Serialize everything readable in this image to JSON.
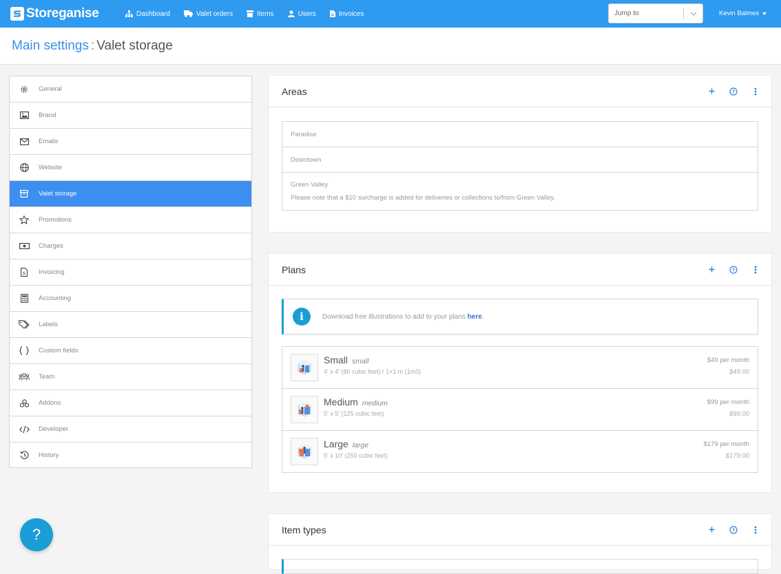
{
  "app": {
    "brand": "Storeganise"
  },
  "nav": {
    "items": [
      {
        "label": "Dashboard",
        "icon": "sitemap-icon"
      },
      {
        "label": "Valet orders",
        "icon": "truck-icon"
      },
      {
        "label": "Items",
        "icon": "box-icon"
      },
      {
        "label": "Users",
        "icon": "user-icon"
      },
      {
        "label": "Invoices",
        "icon": "document-icon"
      }
    ],
    "jump_placeholder": "Jump to",
    "user_name": "Kevin Balmes"
  },
  "header": {
    "crumb": "Main settings",
    "separator": ":",
    "title": "Valet storage"
  },
  "sidebar": {
    "items": [
      {
        "label": "General",
        "icon": "gear-icon"
      },
      {
        "label": "Brand",
        "icon": "image-icon"
      },
      {
        "label": "Emails",
        "icon": "envelope-icon"
      },
      {
        "label": "Website",
        "icon": "globe-icon"
      },
      {
        "label": "Valet storage",
        "icon": "archive-icon",
        "active": true
      },
      {
        "label": "Promotions",
        "icon": "star-icon"
      },
      {
        "label": "Charges",
        "icon": "banknote-icon"
      },
      {
        "label": "Invoicing",
        "icon": "invoice-icon"
      },
      {
        "label": "Accounting",
        "icon": "calculator-icon"
      },
      {
        "label": "Labels",
        "icon": "tags-icon"
      },
      {
        "label": "Custom fields",
        "icon": "braces-icon"
      },
      {
        "label": "Team",
        "icon": "users-icon"
      },
      {
        "label": "Addons",
        "icon": "cubes-icon"
      },
      {
        "label": "Developer",
        "icon": "code-icon"
      },
      {
        "label": "History",
        "icon": "history-icon"
      }
    ]
  },
  "areas": {
    "title": "Areas",
    "items": [
      {
        "name": "Paradise"
      },
      {
        "name": "Downtown"
      },
      {
        "name": "Green Valley",
        "note": "Please note that a $10 surcharge is added for deliveries or collections to/from Green Valley."
      }
    ]
  },
  "plans": {
    "title": "Plans",
    "alert_text": "Download free illustrations to add to your plans ",
    "alert_link": "here",
    "alert_suffix": ".",
    "items": [
      {
        "name": "Small",
        "code": "small",
        "desc": "4' x 4' (80 cubic feet) / 1×1 m (1m3)",
        "price": "$49 per month",
        "amount": "$49.00"
      },
      {
        "name": "Medium",
        "code": "medium",
        "desc": "5' x 5' (125 cubic feet)",
        "price": "$99 per month",
        "amount": "$99.00"
      },
      {
        "name": "Large",
        "code": "large",
        "desc": "5' x 10' (250 cubic feet)",
        "price": "$179 per month",
        "amount": "$179.00"
      }
    ]
  },
  "item_types": {
    "title": "Item types"
  },
  "help": {
    "label": "?"
  },
  "colors": {
    "primary": "#2e9af0",
    "active": "#3c8ff0",
    "info": "#1a9ed5"
  }
}
